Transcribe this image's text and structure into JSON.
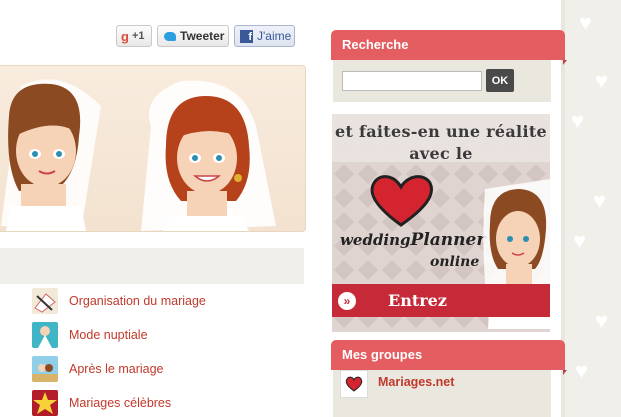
{
  "social": {
    "gplus_label": "+1",
    "tweet_label": "Tweeter",
    "like_label": "J'aime"
  },
  "categories": [
    {
      "label": "Organisation du mariage",
      "icon": "organisation-icon"
    },
    {
      "label": "Mode nuptiale",
      "icon": "bridal-fashion-icon"
    },
    {
      "label": "Après le mariage",
      "icon": "after-wedding-icon"
    },
    {
      "label": "Mariages célèbres",
      "icon": "star-icon"
    }
  ],
  "sidebar": {
    "search": {
      "title": "Recherche",
      "placeholder": "",
      "button": "OK"
    },
    "ad": {
      "line1": "et faites-en une réalite",
      "line2": "avec le",
      "brand_wedding": "wedding",
      "brand_planner": "Planner",
      "brand_online": "online",
      "cta": "Entrez"
    },
    "groups": {
      "title": "Mes groupes",
      "items": [
        {
          "label": "Mariages.net"
        }
      ]
    }
  },
  "colors": {
    "accent": "#e35d61",
    "link": "#c0392b",
    "cta": "#c62a39"
  }
}
